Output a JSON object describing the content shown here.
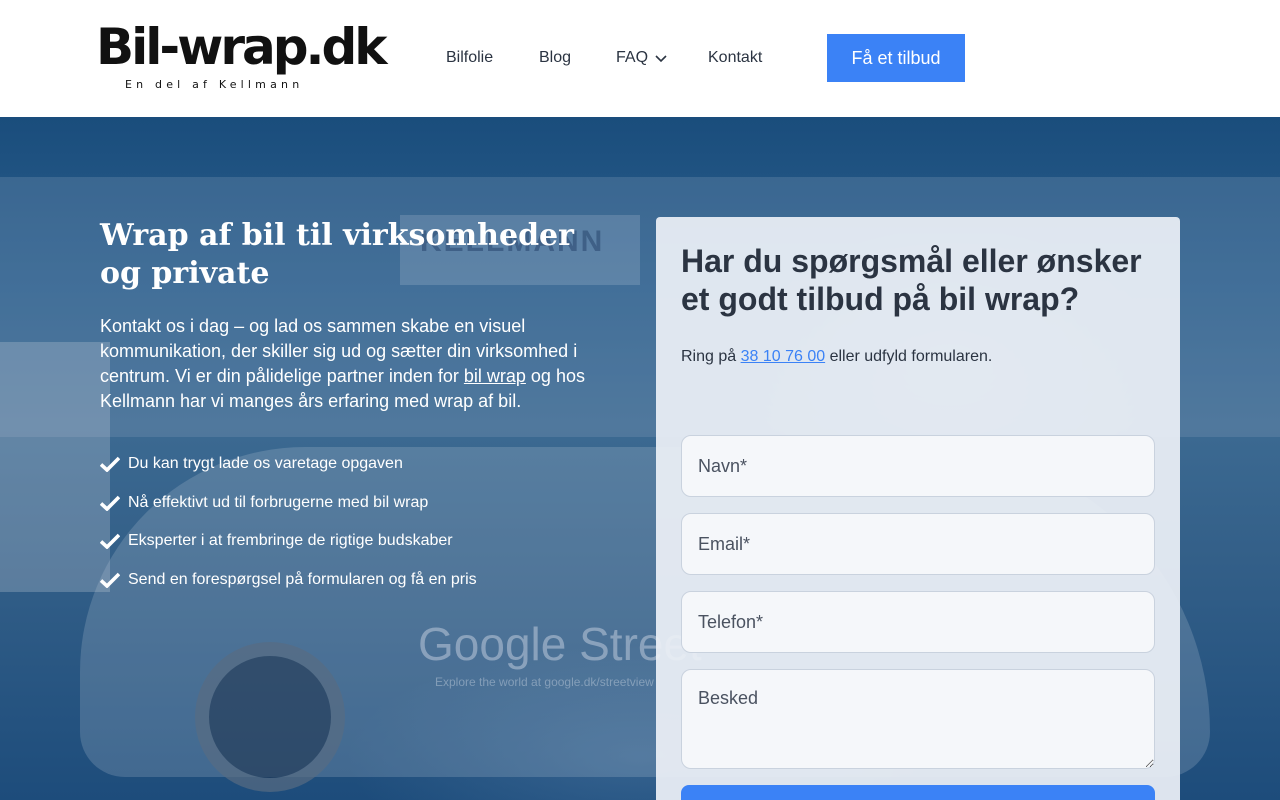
{
  "logo": {
    "name": "Bil-wrap.dk",
    "tagline": "En del af Kellmann"
  },
  "nav": {
    "items": [
      {
        "label": "Bilfolie"
      },
      {
        "label": "Blog"
      },
      {
        "label": "FAQ"
      },
      {
        "label": "Kontakt"
      }
    ],
    "cta_label": "Få et tilbud"
  },
  "colors": {
    "accent": "#3b82f6",
    "text": "#2b3442",
    "hero_overlay": "#1f5285"
  },
  "hero": {
    "title": "Wrap af bil til virksomheder og private",
    "intro_before": "Kontakt os i dag – og lad os sammen skabe en visuel kommunikation, der skiller sig ud og sætter din virksomhed i centrum. Vi er din pålidelige partner inden for ",
    "intro_link": "bil wrap",
    "intro_after": " og hos Kellmann har vi manges års erfaring med wrap af bil.",
    "bullets": [
      "Du kan trygt lade os varetage opgaven",
      "Nå effektivt ud til forbrugerne med bil wrap",
      "Eksperter i at frembringe de rigtige budskaber",
      "Send en forespørgsel på formularen og få en pris"
    ],
    "bullet_icon": "check-icon",
    "background_sign": "KELLMANN",
    "background_car_text": "Google Street",
    "background_car_subtext": "Explore the world at google.dk/streetview"
  },
  "form": {
    "title": "Har du spørgsmål eller ønsker et godt tilbud på bil wrap?",
    "call_prefix": "Ring på ",
    "phone": "38 10 76 00",
    "call_suffix": " eller udfyld formularen.",
    "fields": {
      "name_placeholder": "Navn*",
      "email_placeholder": "Email*",
      "phone_placeholder": "Telefon*",
      "message_placeholder": "Besked"
    }
  }
}
